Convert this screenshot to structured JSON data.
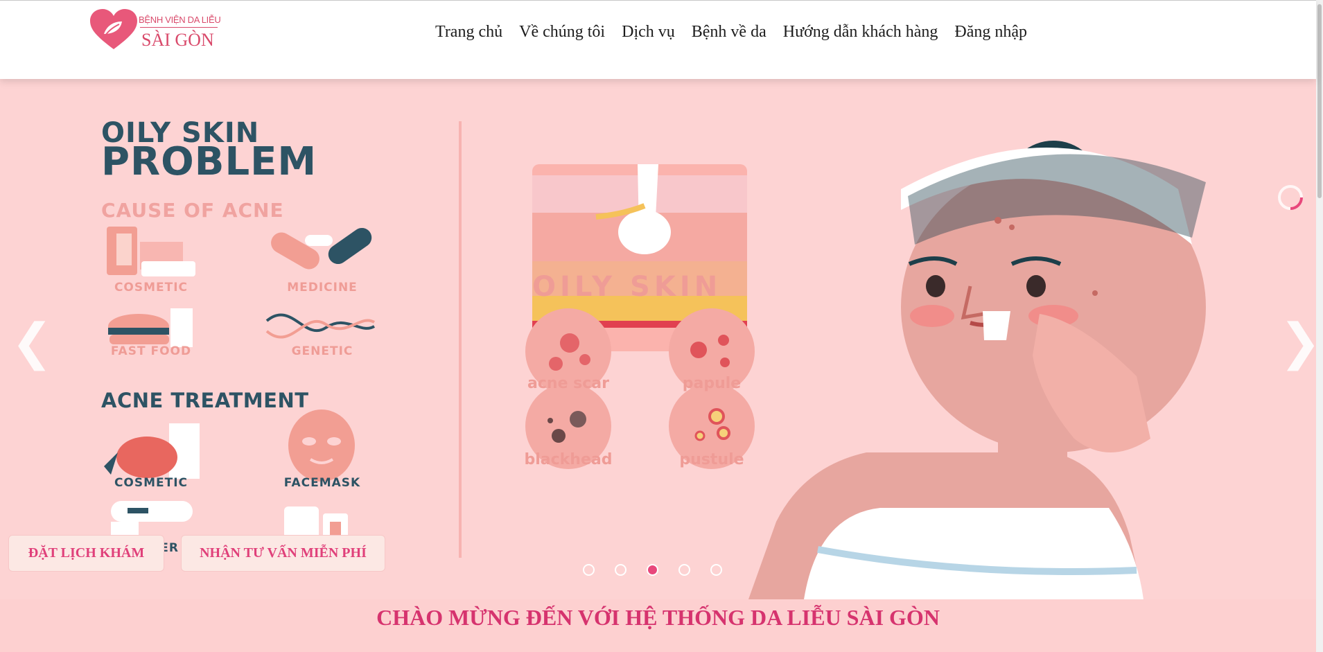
{
  "logo": {
    "line1": "BỆNH VIỆN DA LIỄU",
    "line2": "SÀI GÒN"
  },
  "nav": {
    "items": [
      {
        "label": "Trang chủ"
      },
      {
        "label": "Về chúng tôi"
      },
      {
        "label": "Dịch vụ"
      },
      {
        "label": "Bệnh về da"
      },
      {
        "label": "Hướng dẫn khách hàng"
      },
      {
        "label": "Đăng nhập"
      }
    ]
  },
  "slide": {
    "title1": "OILY SKIN",
    "title2": "PROBLEM",
    "cause_heading": "CAUSE OF ACNE",
    "causes": [
      "COSMETIC",
      "MEDICINE",
      "FAST FOOD",
      "GENETIC"
    ],
    "treatment_heading": "ACNE TREATMENT",
    "treatments": [
      "COSMETIC",
      "FACEMASK",
      "ER"
    ],
    "oily_skin_label": "OILY SKIN",
    "acne_types": [
      "acne scar",
      "papule",
      "blackhead",
      "pustule"
    ]
  },
  "carousel": {
    "prev_icon": "chevron-left-icon",
    "next_icon": "chevron-right-icon",
    "prev_glyph": "❮",
    "next_glyph": "❯",
    "slide_count": 5,
    "active_index": 2
  },
  "buttons": {
    "book": "ĐẶT LỊCH KHÁM",
    "consult": "NHẬN TƯ VẤN MIỄN PHÍ"
  },
  "welcome": {
    "title": "CHÀO MỪNG ĐẾN VỚI HỆ THỐNG DA LIỄU SÀI GÒN"
  },
  "colors": {
    "brand": "#d94a6b",
    "accent": "#e0407a",
    "hero_bg": "#fdd3d3",
    "dark_teal": "#2d5364"
  }
}
